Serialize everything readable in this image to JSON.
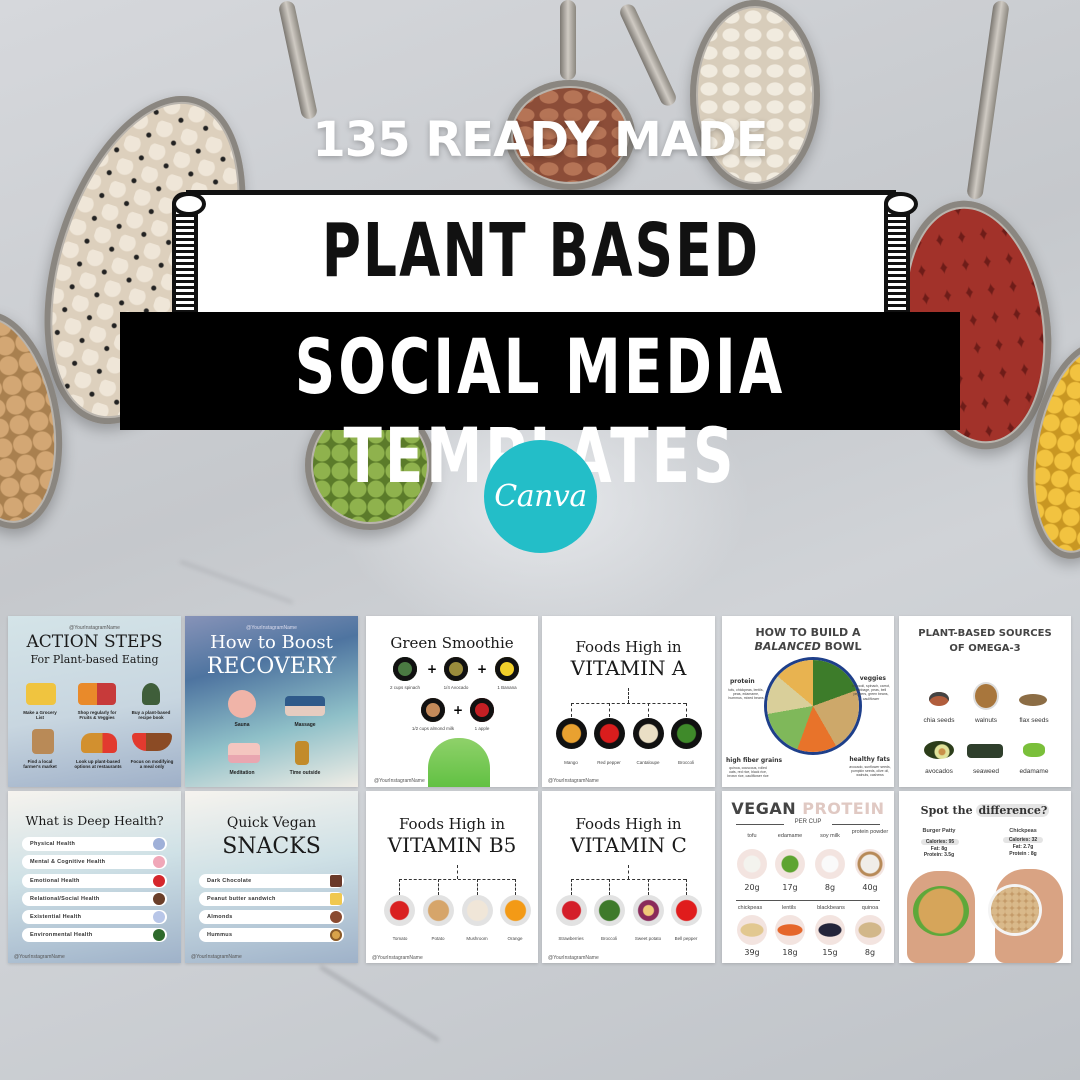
{
  "hero": {
    "kicker": "135 READY MADE",
    "title_line1": "PLANT BASED",
    "title_line2": "SOCIAL MEDIA TEMPLATES",
    "badge_label": "Canva",
    "badge_color": "#23bec8"
  },
  "templates": {
    "handle": "@YourInstagramName",
    "action_steps": {
      "title": "ACTION STEPS",
      "subtitle": "For Plant-based Eating",
      "items": [
        "Make a Grocery List",
        "Shop regularly for Fruits & Veggies",
        "Buy a plant-based recipe book",
        "Find a local farmer's market",
        "Look up plant-based options at restaurants",
        "Focus on modifying a meal only"
      ]
    },
    "recovery": {
      "title_line1": "How to Boost",
      "title_line2": "RECOVERY",
      "items": [
        "Sauna",
        "Massage",
        "Meditation",
        "Time outside"
      ]
    },
    "smoothie": {
      "title": "Green Smoothie",
      "ingredients": [
        "2 cups spinach",
        "1/4 Avocado",
        "1 Banana",
        "1/2 cups almond milk",
        "1 apple"
      ],
      "plus": "+"
    },
    "vitamin_a": {
      "title_line1": "Foods High in",
      "title_line2": "VITAMIN A",
      "foods": [
        "Mango",
        "Red pepper",
        "Cantaloupe",
        "Broccoli"
      ]
    },
    "balanced_bowl": {
      "title_line1": "HOW TO BUILD A",
      "title_italic": "BALANCED",
      "title_rest": "BOWL",
      "sections": [
        {
          "label": "protein",
          "detail": "tofu, chickpeas, lentils, peas, edamame, hummus, mixed beans"
        },
        {
          "label": "veggies",
          "detail": "broccoli, spinach, carrot, cabbage, peas, bell peppers, green beans, cauliflower"
        },
        {
          "label": "high fiber grains",
          "detail": "quinoa, couscous, rolled oats, red rice, black rice, brown rice, cauliflower rice"
        },
        {
          "label": "healthy fats",
          "detail": "avocado, sunflower seeds, pumpkin seeds, olive oil, walnuts, cashews"
        }
      ]
    },
    "omega3": {
      "title_line1": "PLANT-BASED SOURCES",
      "title_line2": "OF OMEGA-3",
      "items": [
        "chia seeds",
        "walnuts",
        "flax seeds",
        "avocados",
        "seaweed",
        "edamame"
      ]
    },
    "deep_health": {
      "title": "What is Deep Health?",
      "items": [
        "Physical Health",
        "Mental & Cognitive Health",
        "Emotional Health",
        "Relational/Social Health",
        "Existential Health",
        "Environmental Health"
      ]
    },
    "vegan_snacks": {
      "title_line1": "Quick Vegan",
      "title_line2": "SNACKS",
      "items": [
        "Dark Chocolate",
        "Peanut butter sandwich",
        "Almonds",
        "Hummus"
      ]
    },
    "vitamin_b5": {
      "title_line1": "Foods High in",
      "title_line2": "VITAMIN B5",
      "foods": [
        "Tomato",
        "Potato",
        "Mushroom",
        "Orange"
      ]
    },
    "vitamin_c": {
      "title_line1": "Foods High in",
      "title_line2": "VITAMIN C",
      "foods": [
        "Strawberries",
        "Broccoli",
        "Sweet potato",
        "Bell pepper"
      ]
    },
    "vegan_protein": {
      "title_a": "VEGAN",
      "title_b": "PROTEIN",
      "subtitle": "PER CUP",
      "accent_color": "#e0c9c3",
      "row1": [
        {
          "name": "tofu",
          "value": "20g"
        },
        {
          "name": "edamame",
          "value": "17g"
        },
        {
          "name": "soy milk",
          "value": "8g"
        },
        {
          "name": "protein powder",
          "value": "40g"
        }
      ],
      "row2": [
        {
          "name": "chickpeas",
          "value": "39g"
        },
        {
          "name": "lentils",
          "value": "18g"
        },
        {
          "name": "blackbeans",
          "value": "15g"
        },
        {
          "name": "quinoa",
          "value": "8g"
        }
      ]
    },
    "spot_difference": {
      "title_a": "Spot the",
      "title_b": "difference?",
      "left": {
        "name": "Burger Patty",
        "calories": "Calories: 95",
        "fat": "Fat: 8g",
        "protein": "Protein: 3.5g"
      },
      "right": {
        "name": "Chickpeas",
        "calories": "Calories: 32",
        "fat": "Fat: 2.7g",
        "protein": "Protein : 8g"
      }
    }
  }
}
